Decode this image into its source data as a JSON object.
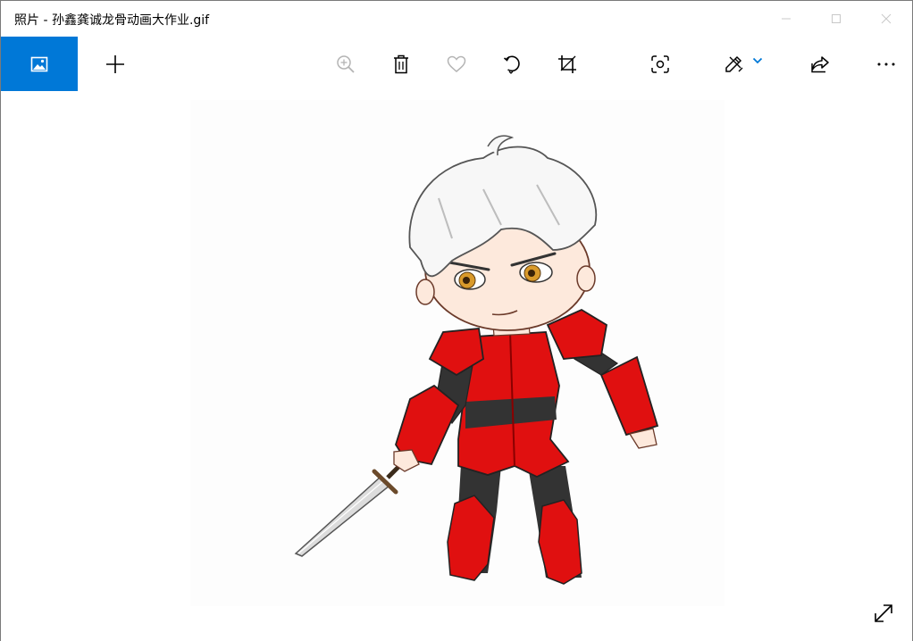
{
  "window": {
    "title": "照片 - 孙鑫龚诚龙骨动画大作业.gif",
    "controls": [
      "minimize-icon",
      "maximize-icon",
      "close-icon"
    ]
  },
  "toolbar": {
    "items": [
      {
        "name": "gallery",
        "icon": "image-icon",
        "active": true
      },
      {
        "name": "add",
        "icon": "plus-icon"
      },
      {
        "name": "zoom",
        "icon": "zoom-in-icon",
        "disabled": true
      },
      {
        "name": "delete",
        "icon": "trash-icon"
      },
      {
        "name": "favorite",
        "icon": "heart-icon",
        "disabled": true
      },
      {
        "name": "rotate",
        "icon": "rotate-icon"
      },
      {
        "name": "crop",
        "icon": "crop-icon"
      },
      {
        "name": "enhance",
        "icon": "focus-icon"
      },
      {
        "name": "edit",
        "icon": "edit-create-icon",
        "has_dropdown": true
      },
      {
        "name": "share",
        "icon": "share-icon"
      },
      {
        "name": "more",
        "icon": "more-icon"
      }
    ],
    "accent_color": "#0078d7"
  },
  "viewer": {
    "image_description_icon": "knight-character-image",
    "expand_icon": "fullscreen-expand-icon"
  }
}
